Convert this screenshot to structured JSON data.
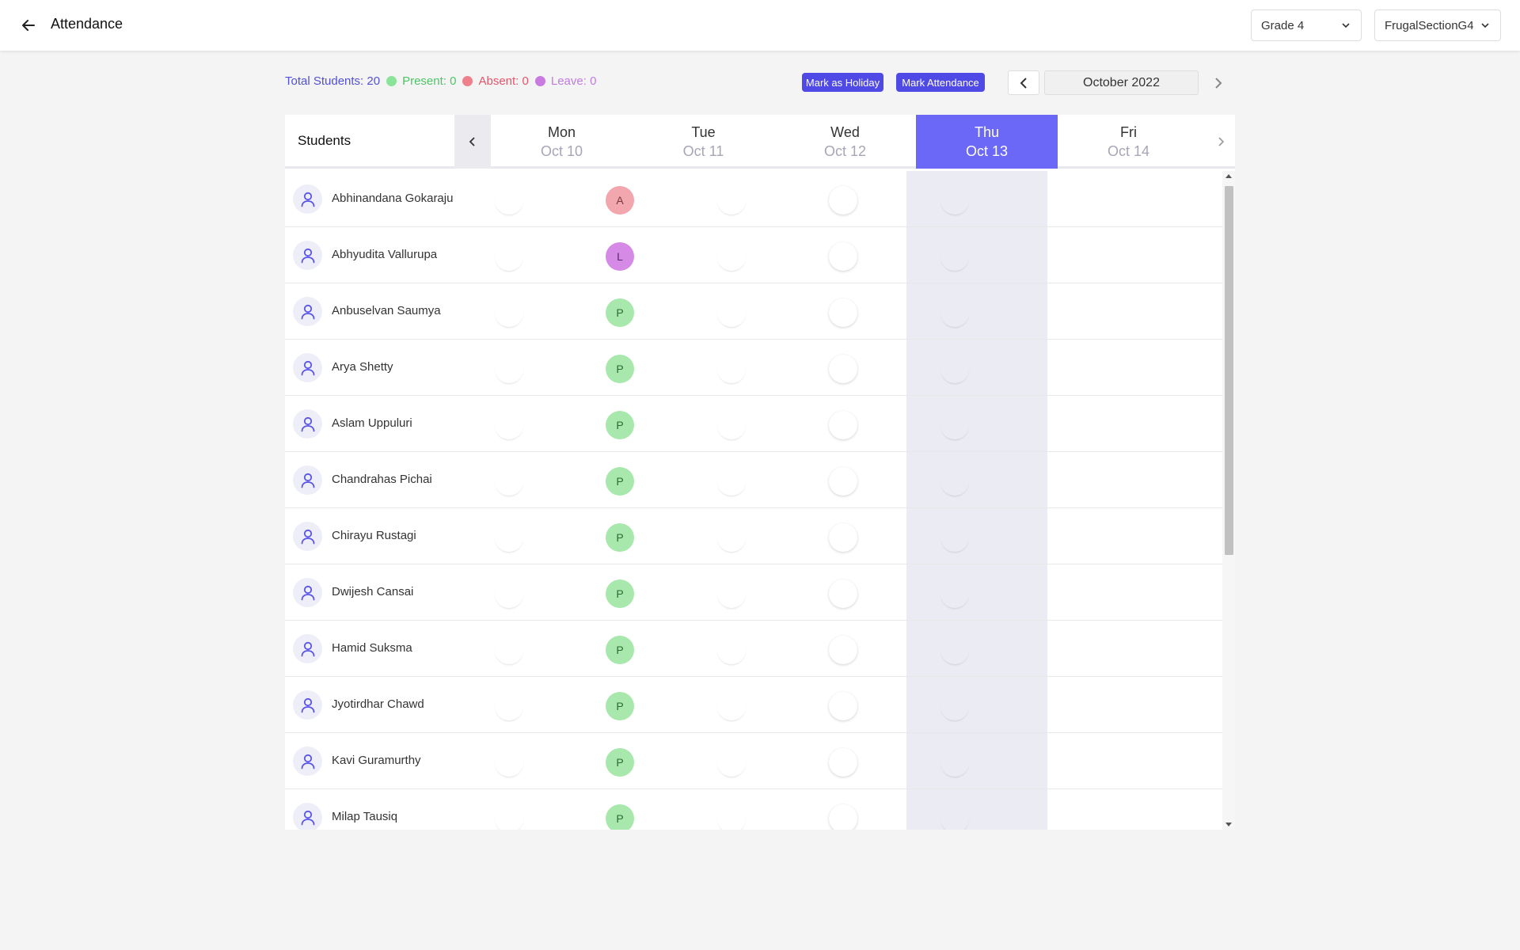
{
  "header": {
    "title": "Attendance",
    "grade_select": "Grade 4",
    "section_select": "FrugalSectionG4"
  },
  "summary": {
    "total": "Total Students: 20",
    "present": "Present: 0",
    "absent": "Absent: 0",
    "leave": "Leave: 0"
  },
  "colors": {
    "accent": "#4f49e6",
    "active_day": "#6c68f7",
    "total_text": "#5250d8",
    "present": "#8be39a",
    "absent": "#ee7f8b",
    "leave": "#c77ae0"
  },
  "actions": {
    "mark_holiday": "Mark as Holiday",
    "mark_attendance": "Mark Attendance"
  },
  "month": "October 2022",
  "table": {
    "students_header": "Students",
    "days": [
      {
        "name": "Mon",
        "date": "Oct 10"
      },
      {
        "name": "Tue",
        "date": "Oct 11"
      },
      {
        "name": "Wed",
        "date": "Oct 12"
      },
      {
        "name": "Thu",
        "date": "Oct 13",
        "active": true
      },
      {
        "name": "Fri",
        "date": "Oct 14"
      }
    ],
    "students": [
      {
        "name": "Abhinandana Gokaraju",
        "status": [
          "",
          "A",
          "",
          "",
          ""
        ]
      },
      {
        "name": "Abhyudita Vallurupa",
        "status": [
          "",
          "L",
          "",
          "",
          ""
        ]
      },
      {
        "name": "Anbuselvan Saumya",
        "status": [
          "",
          "P",
          "",
          "",
          ""
        ]
      },
      {
        "name": "Arya Shetty",
        "status": [
          "",
          "P",
          "",
          "",
          ""
        ]
      },
      {
        "name": "Aslam Uppuluri",
        "status": [
          "",
          "P",
          "",
          "",
          ""
        ]
      },
      {
        "name": "Chandrahas Pichai",
        "status": [
          "",
          "P",
          "",
          "",
          ""
        ]
      },
      {
        "name": "Chirayu Rustagi",
        "status": [
          "",
          "P",
          "",
          "",
          ""
        ]
      },
      {
        "name": "Dwijesh Cansai",
        "status": [
          "",
          "P",
          "",
          "",
          ""
        ]
      },
      {
        "name": "Hamid Suksma",
        "status": [
          "",
          "P",
          "",
          "",
          ""
        ]
      },
      {
        "name": "Jyotirdhar Chawd",
        "status": [
          "",
          "P",
          "",
          "",
          ""
        ]
      },
      {
        "name": "Kavi Guramurthy",
        "status": [
          "",
          "P",
          "",
          "",
          ""
        ]
      },
      {
        "name": "Milap Tausiq",
        "status": [
          "",
          "P",
          "",
          "",
          ""
        ]
      }
    ]
  }
}
